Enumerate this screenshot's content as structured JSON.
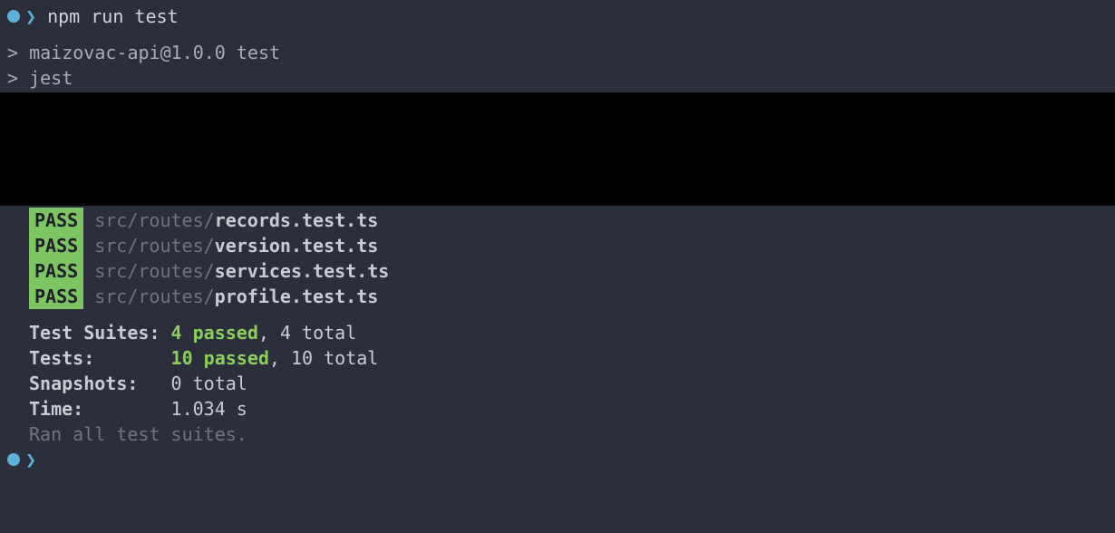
{
  "prompt": {
    "command": "npm run test"
  },
  "header": {
    "line1": "> maizovac-api@1.0.0 test",
    "line2": "> jest"
  },
  "tests": [
    {
      "status": "PASS",
      "path": "src/routes/",
      "file": "records.test.ts"
    },
    {
      "status": "PASS",
      "path": "src/routes/",
      "file": "version.test.ts"
    },
    {
      "status": "PASS",
      "path": "src/routes/",
      "file": "services.test.ts"
    },
    {
      "status": "PASS",
      "path": "src/routes/",
      "file": "profile.test.ts"
    }
  ],
  "summary": {
    "suites_label": "Test Suites: ",
    "suites_passed": "4 passed",
    "suites_total": ", 4 total",
    "tests_label": "Tests:       ",
    "tests_passed": "10 passed",
    "tests_total": ", 10 total",
    "snapshots_label": "Snapshots:   ",
    "snapshots_value": "0 total",
    "time_label": "Time:        ",
    "time_value": "1.034 s",
    "ran": "Ran all test suites."
  }
}
